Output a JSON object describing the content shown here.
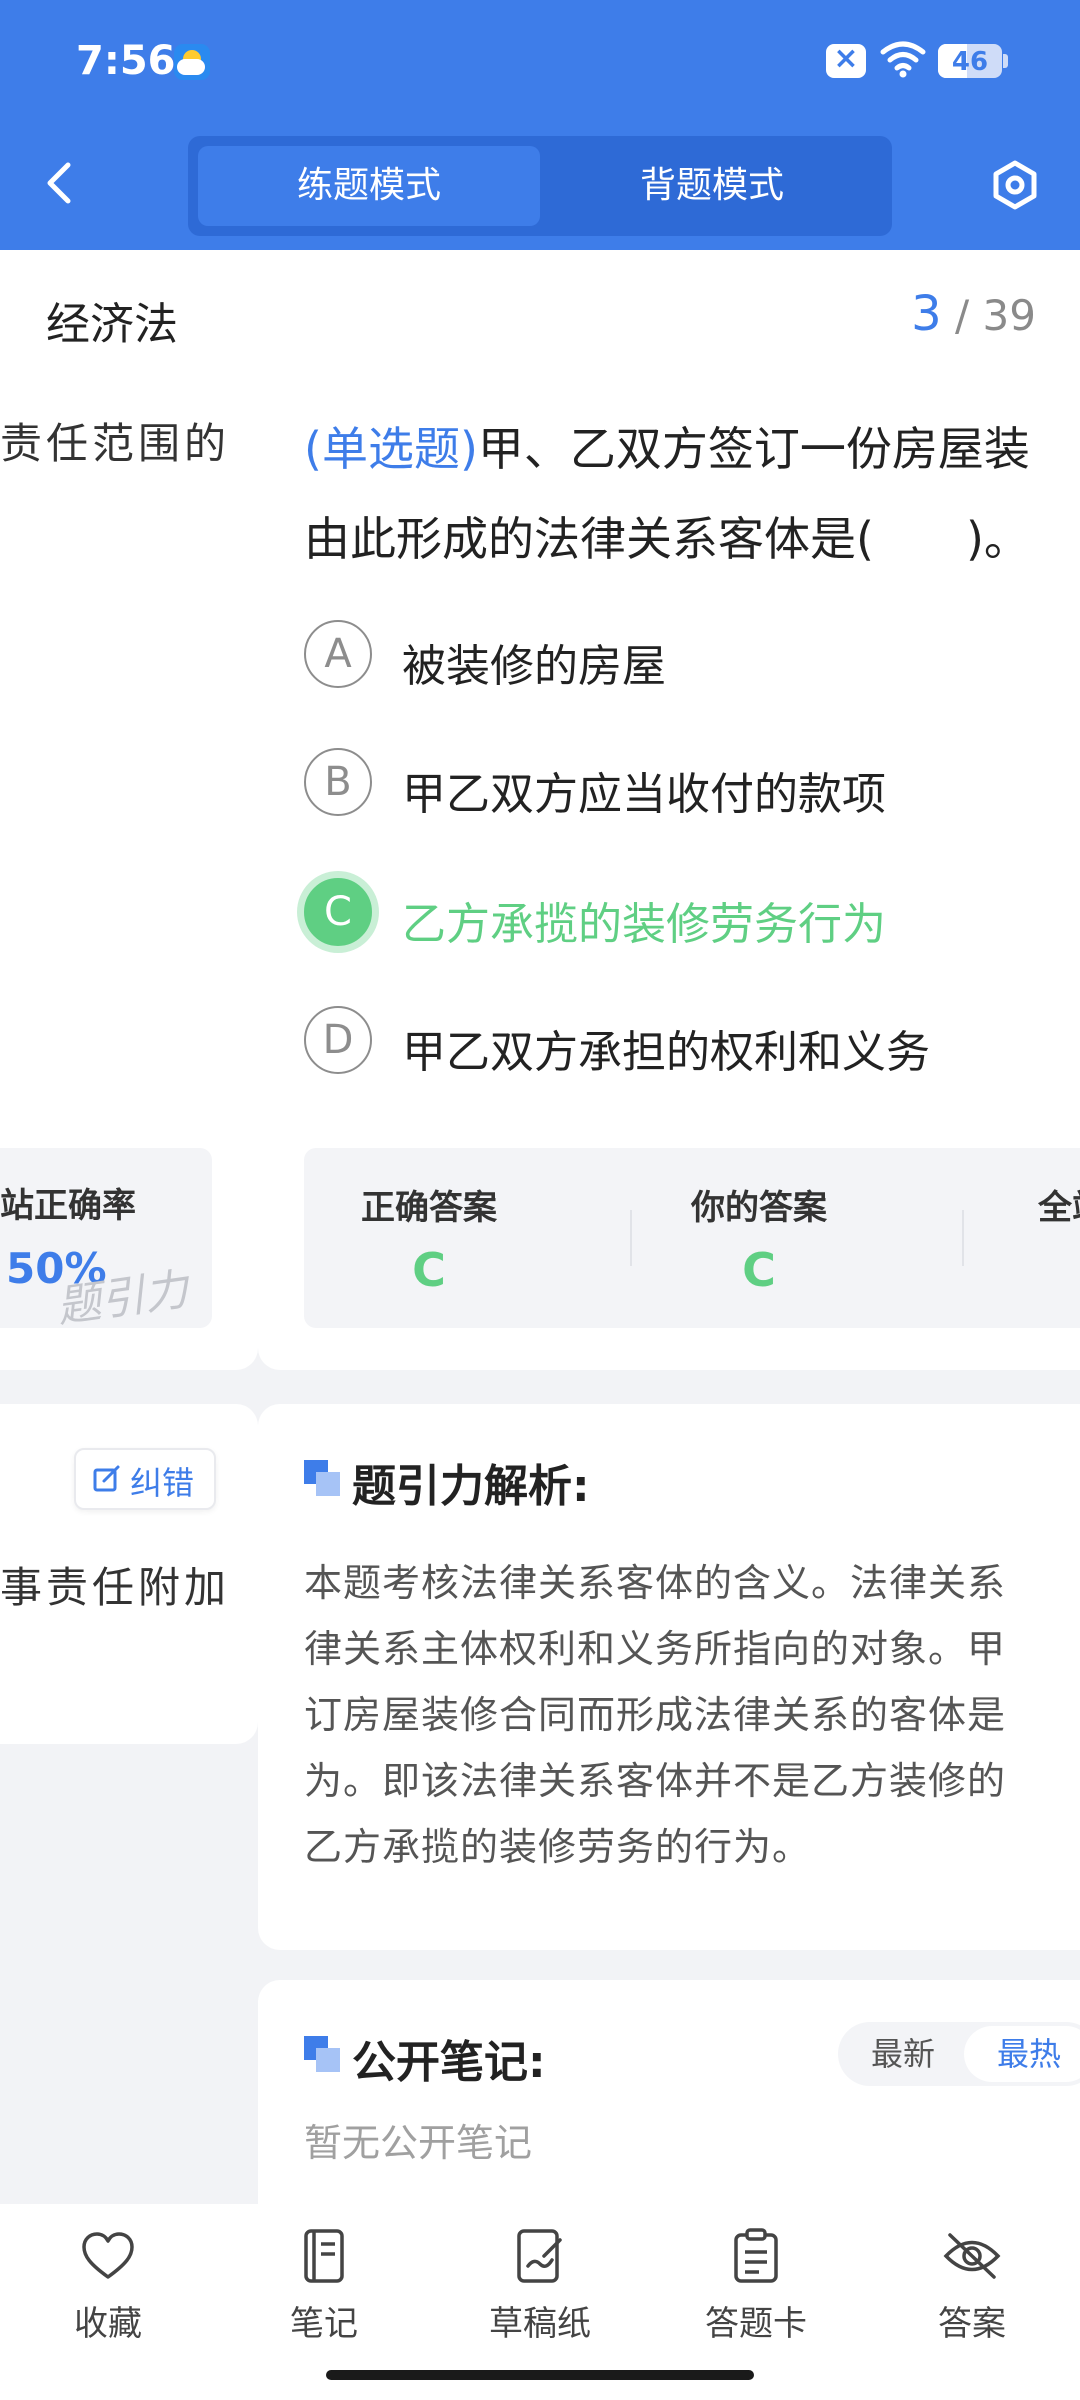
{
  "status_bar": {
    "time": "7:56",
    "battery": "46",
    "battery_level": 0.46
  },
  "header": {
    "modes": [
      {
        "label": "练题模式",
        "active": true
      },
      {
        "label": "背题模式",
        "active": false
      }
    ]
  },
  "subject": {
    "title": "经济法",
    "current": "3",
    "separator": "/",
    "total": "39"
  },
  "left_peek": {
    "question_fragment": "责任范围的",
    "stat_label": "站正确率",
    "stat_value": "50%",
    "watermark": "题引力",
    "fix_label": "纠错",
    "analysis_fragment": "事责任附加"
  },
  "question": {
    "type_label": "(单选题)",
    "line1": "甲、乙双方签订一份房屋装",
    "line2": "由此形成的法律关系客体是(　　)。",
    "options": [
      {
        "key": "A",
        "text": "被装修的房屋",
        "state": "normal"
      },
      {
        "key": "B",
        "text": "甲乙双方应当收付的款项",
        "state": "normal"
      },
      {
        "key": "C",
        "text": "乙方承揽的装修劳务行为",
        "state": "correct"
      },
      {
        "key": "D",
        "text": "甲乙双方承担的权利和义务",
        "state": "normal"
      }
    ]
  },
  "answer_summary": {
    "correct_label": "正确答案",
    "correct_value": "C",
    "yours_label": "你的答案",
    "yours_value": "C",
    "third_label_fragment": "全站"
  },
  "analysis": {
    "title": "题引力解析:",
    "lines": [
      "本题考核法律关系客体的含义。法律关系",
      "律关系主体权利和义务所指向的对象。甲",
      "订房屋装修合同而形成法律关系的客体是",
      "为。即该法律关系客体并不是乙方装修的",
      "乙方承揽的装修劳务的行为。"
    ]
  },
  "notes": {
    "title": "公开笔记:",
    "sort_latest": "最新",
    "sort_hot": "最热",
    "empty_text": "暂无公开笔记"
  },
  "bottom_nav": [
    {
      "label": "收藏",
      "icon": "heart-icon"
    },
    {
      "label": "笔记",
      "icon": "notebook-icon"
    },
    {
      "label": "草稿纸",
      "icon": "draft-paper-icon"
    },
    {
      "label": "答题卡",
      "icon": "answer-sheet-icon"
    },
    {
      "label": "答案",
      "icon": "eye-off-icon"
    }
  ],
  "colors": {
    "primary": "#3e7de9",
    "correct": "#5fcf83",
    "muted": "#8a8a8a"
  }
}
